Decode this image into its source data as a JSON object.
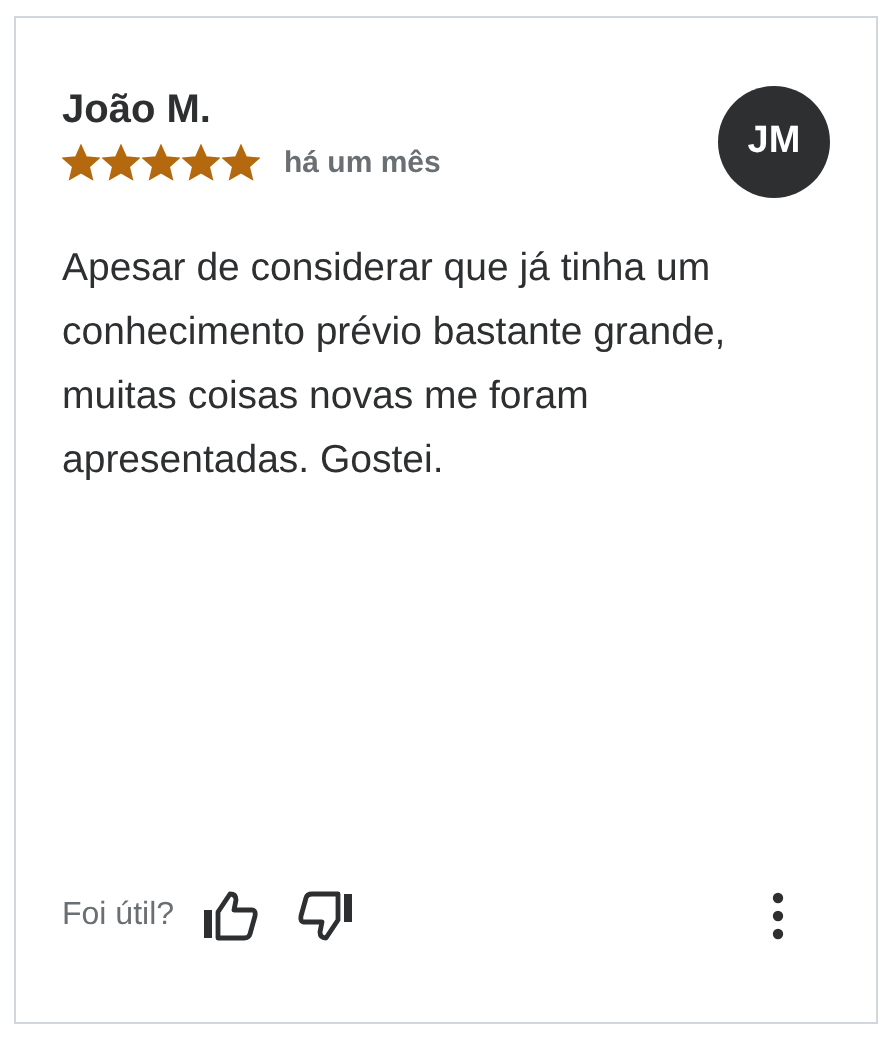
{
  "review": {
    "author": "João M.",
    "stars": 5,
    "time": "há um mês",
    "avatar_initials": "JM",
    "text": "Apesar de considerar que já tinha um conhecimento prévio bastante grande, muitas coisas novas me foram apresentadas. Gostei."
  },
  "feedback": {
    "prompt": "Foi útil?"
  }
}
